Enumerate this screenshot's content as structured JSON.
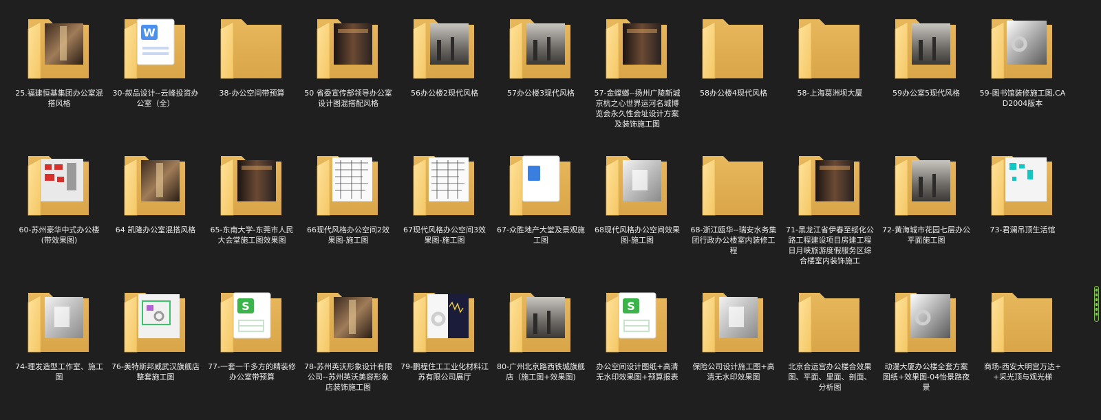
{
  "folders": [
    {
      "label": "25.福建恒基集团办公室混搭风格",
      "thumb": "photo-warm"
    },
    {
      "label": "30-叙品设计--云峰投资办公室（全）",
      "thumb": "doc-w"
    },
    {
      "label": "38-办公空间带预算",
      "thumb": "none"
    },
    {
      "label": "50 省委宣传部领导办公室设计图混搭配风格",
      "thumb": "photo-dark"
    },
    {
      "label": "56办公楼2现代风格",
      "thumb": "photo-gray"
    },
    {
      "label": "57办公楼3现代风格",
      "thumb": "photo-gray"
    },
    {
      "label": "57-金螳螂--扬州广陵新城京杭之心世界运河名城博览会永久性会址设计方案及装饰施工图",
      "thumb": "photo-dark"
    },
    {
      "label": "58办公楼4现代风格",
      "thumb": "none"
    },
    {
      "label": "58-上海葛洲坝大厦",
      "thumb": "none"
    },
    {
      "label": "59办公室5现代风格",
      "thumb": "photo-gray"
    },
    {
      "label": "59-图书馆装修施工图,CAD2004版本",
      "thumb": "gear-photo"
    },
    {
      "label": "60-苏州豪华中式办公楼(带效果图)",
      "thumb": "red-plan"
    },
    {
      "label": "64 凯隆办公室混搭风格",
      "thumb": "photo-warm"
    },
    {
      "label": "65-东南大学-东莞市人民大会堂施工图效果图",
      "thumb": "photo-dark"
    },
    {
      "label": "66现代风格办公空间2效果图-施工图",
      "thumb": "cad"
    },
    {
      "label": "67现代风格办公空间3效果图-施工图",
      "thumb": "cad"
    },
    {
      "label": "67-众胜地产大堂及景观施工图",
      "thumb": "doc-blue"
    },
    {
      "label": "68现代风格办公空间效果图-施工图",
      "thumb": "photo-light"
    },
    {
      "label": "68-浙江瓯华--瑞安水务集团行政办公楼室内装修工程",
      "thumb": "none"
    },
    {
      "label": "71-黑龙江省伊春至绥化公路工程建设项目房建工程日月峡旅游度假服务区综合楼室内装饰施工",
      "thumb": "photo-dark"
    },
    {
      "label": "72-黄海城市花园七层办公平面施工图",
      "thumb": "photo-gray"
    },
    {
      "label": "73-君澜吊顶生活馆",
      "thumb": "cyan-plan"
    },
    {
      "label": "74-理发造型工作室、施工图",
      "thumb": "photo-light"
    },
    {
      "label": "76-美特斯邦威武汉旗舰店整套施工图",
      "thumb": "green-plan"
    },
    {
      "label": "77-一套一千多方的精装修办公室带预算",
      "thumb": "doc-s"
    },
    {
      "label": "78-苏州英沃形象设计有限公司--苏州英沃美容形象店装饰施工图",
      "thumb": "photo-warm"
    },
    {
      "label": "79-鹏程住工工业化材料江苏有限公司展厅",
      "thumb": "gear-chart"
    },
    {
      "label": "80-广州北京路西铁城旗舰店（施工图+效果图)",
      "thumb": "photo-gray"
    },
    {
      "label": "办公空间设计图纸+高清无水印效果图+预算报表",
      "thumb": "doc-s"
    },
    {
      "label": "保险公司设计施工图+高清无水印效果图",
      "thumb": "photo-light"
    },
    {
      "label": "北京合运宫办公楼合效果图、平面、里面、剖面、分析图",
      "thumb": "none"
    },
    {
      "label": "动漫大厦办公楼全套方案图纸+效果图-04怡景路夜景",
      "thumb": "gear-photo"
    },
    {
      "label": "商场-西安大明宫万达++采光顶与观光梯",
      "thumb": "none"
    }
  ]
}
